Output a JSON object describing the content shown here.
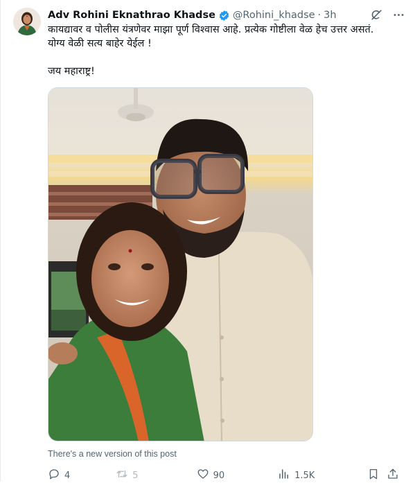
{
  "author": {
    "name": "Adv Rohini Eknathrao Khadse",
    "handle": "@Rohini_khadse",
    "separator": "·",
    "time": "3h",
    "verified_color": "#1d9bf0"
  },
  "post": {
    "line1": "कायद्यावर व पोलीस यंत्रणेवर माझा पूर्ण विश्वास आहे. प्रत्येक गोष्टीला वेळ हेच उत्तर असतं.",
    "line2": "योग्य वेळी सत्य बाहेर येईल !",
    "line3": "जय महाराष्ट्र!"
  },
  "notice": "There's a new version of this post",
  "metrics": {
    "replies": "4",
    "reposts": "5",
    "likes": "90",
    "views": "1.5K"
  },
  "icons": {
    "top": [
      "grok-icon",
      "more-icon"
    ],
    "actions": [
      "reply-icon",
      "repost-icon",
      "like-icon",
      "views-icon",
      "bookmark-icon",
      "share-icon"
    ]
  },
  "colors": {
    "text": "#0f1419",
    "secondary": "#536471",
    "accent": "#1d9bf0"
  }
}
